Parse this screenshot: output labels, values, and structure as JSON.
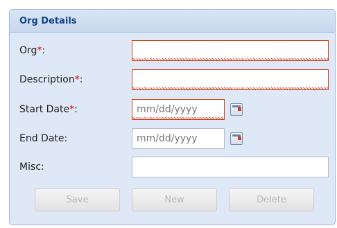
{
  "panel": {
    "title": "Org Details"
  },
  "fields": {
    "org": {
      "label": "Org",
      "required_mark": "*",
      "colon": ":",
      "value": ""
    },
    "description": {
      "label": "Description",
      "required_mark": "*",
      "colon": ":",
      "value": ""
    },
    "start_date": {
      "label": "Start Date",
      "required_mark": "*",
      "colon": ":",
      "placeholder": "mm/dd/yyyy"
    },
    "end_date": {
      "label": "End Date:",
      "placeholder": "mm/dd/yyyy"
    },
    "misc": {
      "label": "Misc:",
      "value": ""
    }
  },
  "buttons": {
    "save": "Save",
    "new": "New",
    "delete": "Delete"
  },
  "colors": {
    "required": "#e00000",
    "invalid_border": "#d04010",
    "header_text": "#15428b"
  }
}
